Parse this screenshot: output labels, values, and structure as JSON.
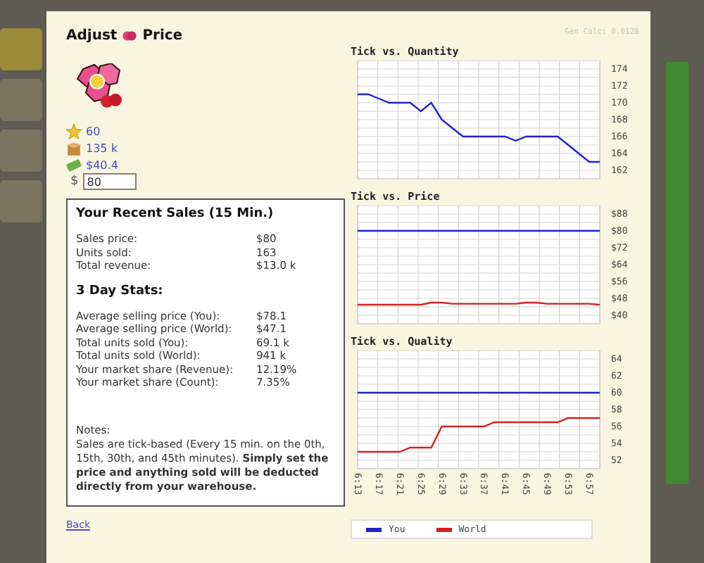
{
  "title": {
    "before": "Adjust",
    "after": "Price"
  },
  "stats": [
    {
      "kind": "level",
      "text": "60"
    },
    {
      "kind": "stock",
      "text": "135 k"
    },
    {
      "kind": "cost",
      "text": "$40.4"
    }
  ],
  "price_field": {
    "currency": "$",
    "value": "80"
  },
  "recent_sales": {
    "heading": "Your Recent Sales (15 Min.)",
    "rows": [
      {
        "label": "Sales price:",
        "value": "$80"
      },
      {
        "label": "Units sold:",
        "value": "163"
      },
      {
        "label": "Total revenue:",
        "value": "$13.0 k"
      }
    ]
  },
  "three_day": {
    "heading": "3 Day Stats:",
    "rows": [
      {
        "label": "Average selling price (You):",
        "value": "$78.1"
      },
      {
        "label": "Average selling price (World):",
        "value": "$47.1"
      },
      {
        "label": "Total units sold (You):",
        "value": "69.1 k"
      },
      {
        "label": "Total units sold (World):",
        "value": "941 k"
      },
      {
        "label": "Your market share (Revenue):",
        "value": "12.19%"
      },
      {
        "label": "Your market share (Count):",
        "value": "7.35%"
      }
    ]
  },
  "notes": {
    "label": "Notes:",
    "text": "Sales are tick-based (Every 15 min. on the 0th, 15th, 30th, and 45th minutes). **Simply set the price and anything sold will be deducted directly from your warehouse.**"
  },
  "back_link": "Back",
  "gen_calc": "Gen Calc: 0.0128",
  "charts": [
    {
      "chart_data": {
        "type": "line",
        "title": "Tick vs. Quantity",
        "grid": true,
        "ylim": [
          161,
          175
        ],
        "yticks": [
          162,
          164,
          166,
          168,
          170,
          172,
          174
        ],
        "series": [
          {
            "color": "#2222cc",
            "values": [
              171,
              171,
              170.5,
              170,
              170,
              170,
              169,
              170,
              168,
              167,
              166,
              166,
              166,
              166,
              166,
              165.5,
              166,
              166,
              166,
              166,
              165,
              164,
              163,
              163
            ]
          }
        ]
      }
    },
    {
      "chart_data": {
        "type": "line",
        "title": "Tick vs. Price",
        "grid": true,
        "ylim": [
          36,
          92
        ],
        "yticks": [
          {
            "value": 40,
            "label": "$40"
          },
          {
            "value": 48,
            "label": "$48"
          },
          {
            "value": 56,
            "label": "$56"
          },
          {
            "value": 64,
            "label": "$64"
          },
          {
            "value": 72,
            "label": "$72"
          },
          {
            "value": 80,
            "label": "$80"
          },
          {
            "value": 88,
            "label": "$88"
          }
        ],
        "series": [
          {
            "color": "#2222cc",
            "values": [
              80,
              80,
              80,
              80,
              80,
              80,
              80,
              80,
              80,
              80,
              80,
              80,
              80,
              80,
              80,
              80,
              80,
              80,
              80,
              80,
              80,
              80,
              80,
              80
            ]
          },
          {
            "color": "#d42020",
            "values": [
              45,
              45,
              45,
              45,
              45,
              45,
              45,
              46,
              46,
              45.5,
              45.5,
              45.5,
              45.5,
              45.5,
              45.5,
              45.5,
              46,
              46,
              45.5,
              45.5,
              45.5,
              45.5,
              45.5,
              45
            ]
          }
        ]
      }
    },
    {
      "chart_data": {
        "type": "line",
        "title": "Tick vs. Quality",
        "grid": true,
        "categories": [
          "6:13",
          null,
          "6:17",
          null,
          "6:21",
          null,
          "6:25",
          null,
          "6:29",
          null,
          "6:33",
          null,
          "6:37",
          null,
          "6:41",
          null,
          "6:45",
          null,
          "6:49",
          null,
          "6:53",
          null,
          "6:57",
          null
        ],
        "ylim": [
          51,
          65
        ],
        "yticks": [
          52,
          54,
          56,
          58,
          60,
          62,
          64
        ],
        "series": [
          {
            "name": "You",
            "color": "#2222cc",
            "values": [
              60,
              60,
              60,
              60,
              60,
              60,
              60,
              60,
              60,
              60,
              60,
              60,
              60,
              60,
              60,
              60,
              60,
              60,
              60,
              60,
              60,
              60,
              60,
              60
            ]
          },
          {
            "name": "World",
            "color": "#d42020",
            "values": [
              53,
              53,
              53,
              53,
              53,
              53.5,
              53.5,
              53.5,
              56,
              56,
              56,
              56,
              56,
              56.5,
              56.5,
              56.5,
              56.5,
              56.5,
              56.5,
              56.5,
              57,
              57,
              57,
              57
            ]
          }
        ]
      }
    }
  ]
}
